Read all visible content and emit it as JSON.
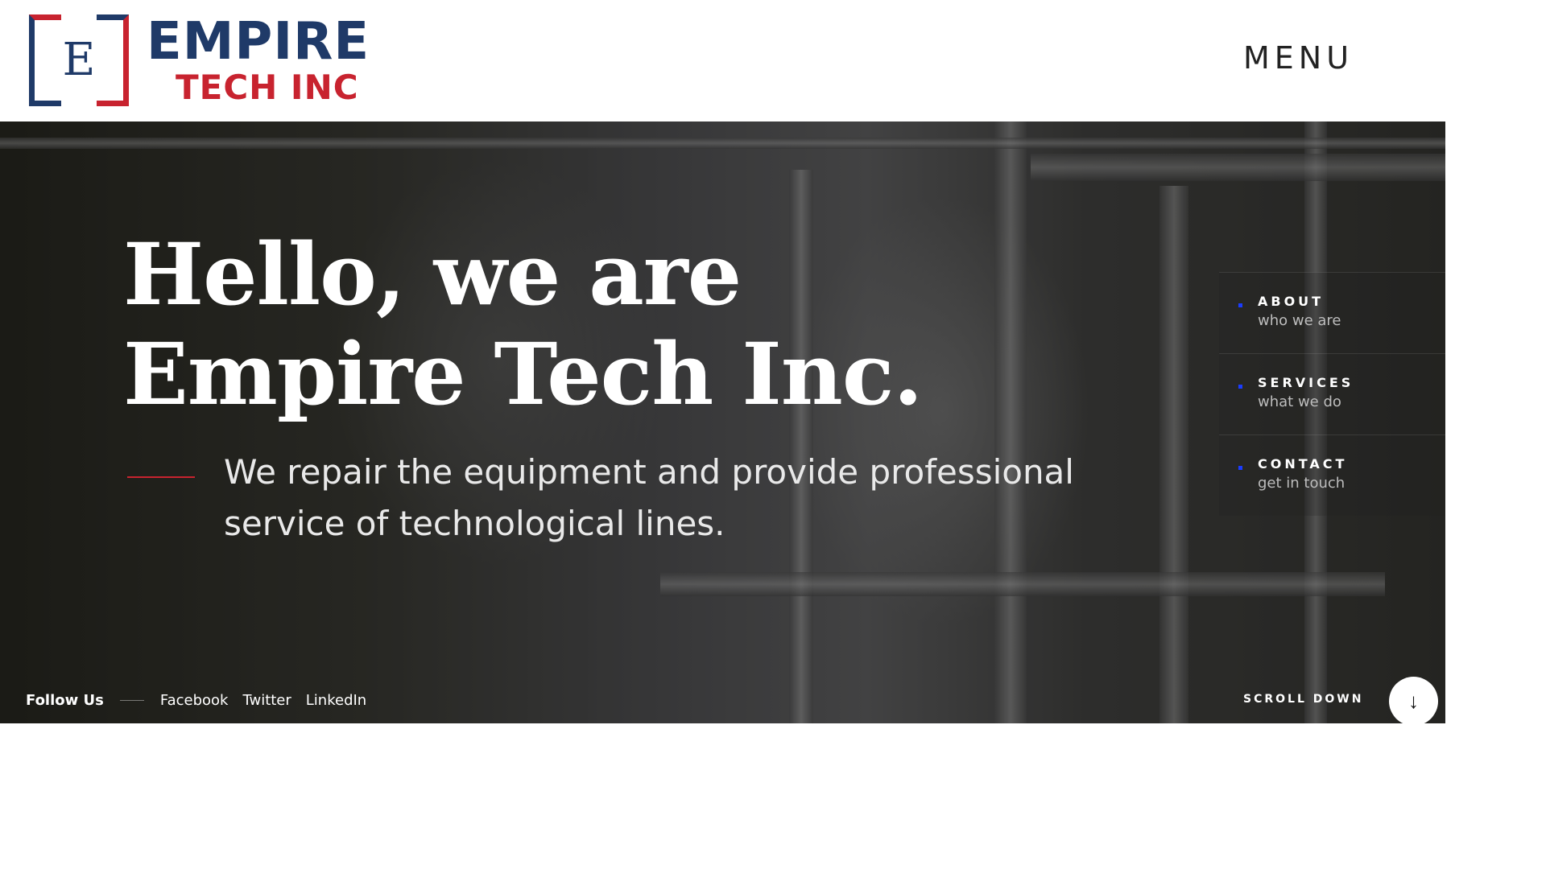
{
  "header": {
    "logo": {
      "mark_letter": "E",
      "word_top": "EMPIRE",
      "word_bottom": "TECH INC"
    },
    "menu_label": "MENU"
  },
  "hero": {
    "title_line_1": "Hello, we are",
    "title_line_2": "Empire Tech Inc.",
    "subtitle": "We repair the equipment and provide professional service of technological lines."
  },
  "side_nav": {
    "items": [
      {
        "title": "ABOUT",
        "sub": "who we are"
      },
      {
        "title": "SERVICES",
        "sub": "what we do"
      },
      {
        "title": "CONTACT",
        "sub": "get in touch"
      }
    ]
  },
  "social": {
    "label": "Follow Us",
    "links": [
      "Facebook",
      "Twitter",
      "LinkedIn"
    ]
  },
  "scroll": {
    "label": "SCROLL DOWN",
    "icon": "arrow-down-icon",
    "glyph": "↓"
  },
  "colors": {
    "brand_blue": "#1f3a68",
    "brand_red": "#c8232f",
    "nav_dot": "#1a3cff"
  }
}
